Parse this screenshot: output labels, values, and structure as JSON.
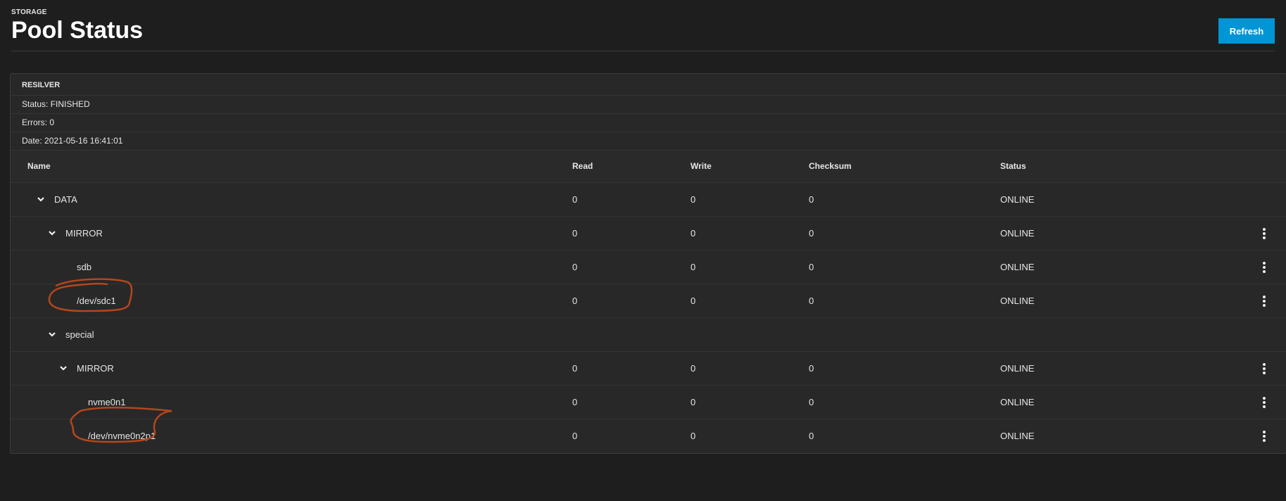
{
  "header": {
    "breadcrumb": "STORAGE",
    "title": "Pool Status",
    "refresh_label": "Refresh"
  },
  "resilver": {
    "title": "RESILVER",
    "status": "Status: FINISHED",
    "errors": "Errors: 0",
    "date": "Date: 2021-05-16 16:41:01"
  },
  "table": {
    "columns": {
      "name": "Name",
      "read": "Read",
      "write": "Write",
      "checksum": "Checksum",
      "status": "Status"
    },
    "rows": [
      {
        "name": "DATA",
        "read": "0",
        "write": "0",
        "checksum": "0",
        "status": "ONLINE"
      },
      {
        "name": "MIRROR",
        "read": "0",
        "write": "0",
        "checksum": "0",
        "status": "ONLINE"
      },
      {
        "name": "sdb",
        "read": "0",
        "write": "0",
        "checksum": "0",
        "status": "ONLINE"
      },
      {
        "name": "/dev/sdc1",
        "read": "0",
        "write": "0",
        "checksum": "0",
        "status": "ONLINE"
      },
      {
        "name": "special",
        "read": "",
        "write": "",
        "checksum": "",
        "status": ""
      },
      {
        "name": "MIRROR",
        "read": "0",
        "write": "0",
        "checksum": "0",
        "status": "ONLINE"
      },
      {
        "name": "nvme0n1",
        "read": "0",
        "write": "0",
        "checksum": "0",
        "status": "ONLINE"
      },
      {
        "name": "/dev/nvme0n2p1",
        "read": "0",
        "write": "0",
        "checksum": "0",
        "status": "ONLINE"
      }
    ]
  },
  "icons": {
    "expand": "chevron-down-icon",
    "row_menu": "more-vertical-icon"
  },
  "colors": {
    "accent": "#0095d5",
    "background": "#1e1e1e",
    "card": "#282828",
    "annotation": "#b3471c"
  }
}
